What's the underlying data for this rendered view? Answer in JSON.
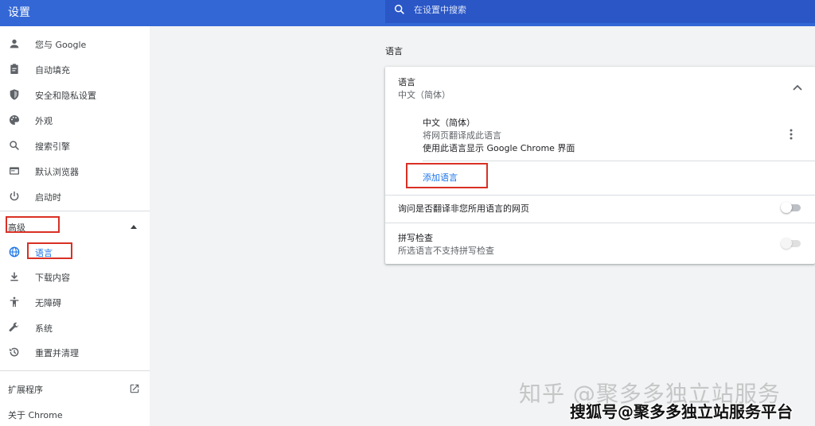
{
  "header": {
    "title": "设置",
    "search_placeholder": "在设置中搜索"
  },
  "sidebar": {
    "items": [
      {
        "label": "您与 Google",
        "icon": "person-icon"
      },
      {
        "label": "自动填充",
        "icon": "clipboard-icon"
      },
      {
        "label": "安全和隐私设置",
        "icon": "shield-icon"
      },
      {
        "label": "外观",
        "icon": "palette-icon"
      },
      {
        "label": "搜索引擎",
        "icon": "search-icon"
      },
      {
        "label": "默认浏览器",
        "icon": "browser-icon"
      },
      {
        "label": "启动时",
        "icon": "power-icon"
      }
    ],
    "advanced_label": "高级",
    "advanced_items": [
      {
        "label": "语言",
        "icon": "globe-icon"
      },
      {
        "label": "下载内容",
        "icon": "download-icon"
      },
      {
        "label": "无障碍",
        "icon": "accessibility-icon"
      },
      {
        "label": "系统",
        "icon": "wrench-icon"
      },
      {
        "label": "重置并清理",
        "icon": "history-icon"
      }
    ],
    "extensions_label": "扩展程序",
    "about_label": "关于 Chrome"
  },
  "main": {
    "section_title": "语言",
    "language": {
      "title": "语言",
      "subtitle": "中文（简体）",
      "entry_name": "中文（简体）",
      "entry_line1": "将网页翻译成此语言",
      "entry_line2": "使用此语言显示 Google Chrome 界面",
      "add_language": "添加语言"
    },
    "translate_offer": {
      "label": "询问是否翻译非您所用语言的网页",
      "enabled": false
    },
    "spellcheck": {
      "title": "拼写检查",
      "subtitle": "所选语言不支持拼写检查",
      "enabled": false
    }
  },
  "watermarks": {
    "zhihu": "知乎 @聚多多独立站服务",
    "sohu": "搜狐号@聚多多独立站服务平台"
  },
  "colors": {
    "header": "#3367d6",
    "accent": "#1a73e8",
    "highlight_box": "#d93025"
  }
}
